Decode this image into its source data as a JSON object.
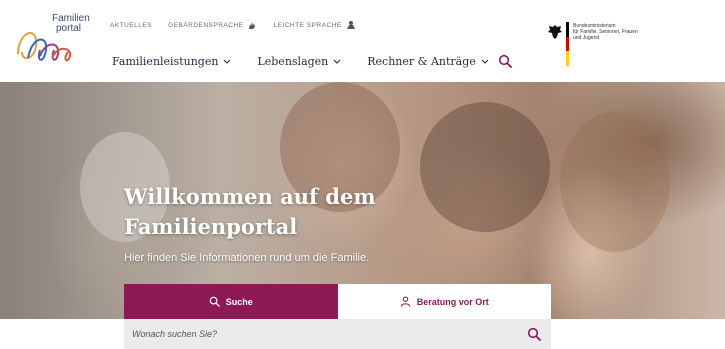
{
  "brand": {
    "logo_line1": "Familien",
    "logo_line2": "portal"
  },
  "service_links": [
    {
      "label": "Aktuelles",
      "icon": "none"
    },
    {
      "label": "Gebärdensprache",
      "icon": "sign-language-icon"
    },
    {
      "label": "Leichte Sprache",
      "icon": "easy-language-icon"
    }
  ],
  "nav": {
    "items": [
      {
        "label": "Familienleistungen"
      },
      {
        "label": "Lebenslagen"
      },
      {
        "label": "Rechner & Anträge"
      }
    ]
  },
  "ministry": {
    "line1": "Bundesministerium",
    "line2": "für Familie, Senioren, Frauen",
    "line3": "und Jugend"
  },
  "hero": {
    "title": "Willkommen auf dem Familienportal",
    "subtitle": "Hier finden Sie Informationen rund um die Familie."
  },
  "tabs": {
    "search_label": "Suche",
    "advice_label": "Beratung vor Ort"
  },
  "search": {
    "placeholder": "Wonach suchen Sie?",
    "value": ""
  },
  "colors": {
    "accent": "#8d1a54",
    "nav_text": "#1f2a40",
    "search_bg": "#ebebeb"
  }
}
